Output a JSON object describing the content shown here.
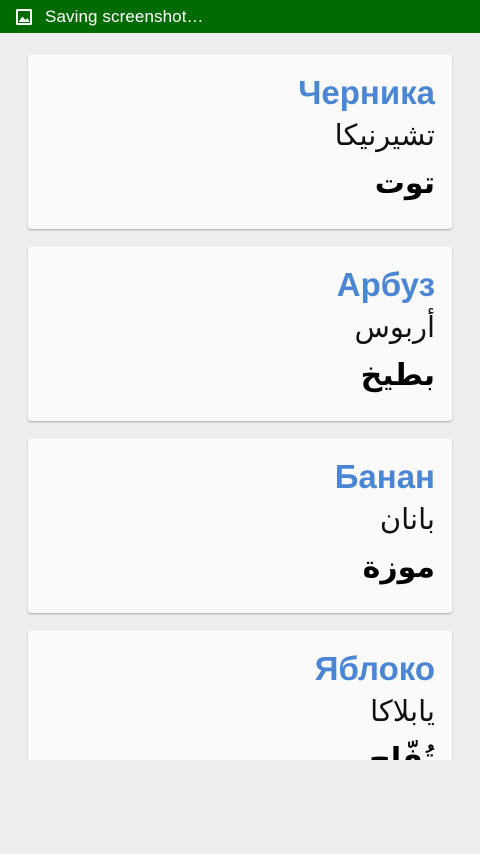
{
  "status_bar": {
    "text": "Saving screenshot…",
    "icon": "image-icon",
    "color": "#006b00"
  },
  "accent_color": "#4a86d4",
  "cards": [
    {
      "title": "Черника",
      "transliteration": "تشيرنيكا",
      "arabic": "توت"
    },
    {
      "title": "Арбуз",
      "transliteration": "أربوس",
      "arabic": "بطيخ"
    },
    {
      "title": "Банан",
      "transliteration": "بانان",
      "arabic": "موزة"
    },
    {
      "title": "Яблоко",
      "transliteration": "يابلاكا",
      "arabic": "تُفّاح"
    }
  ]
}
